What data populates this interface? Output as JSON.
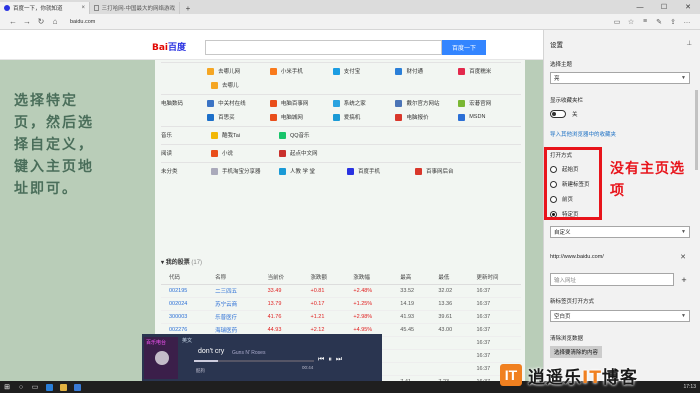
{
  "browser": {
    "tabs": [
      {
        "title": "百度一下，你就知道",
        "active": true
      },
      {
        "title": "三打哈网-中国最大的网络游戏",
        "active": false
      }
    ],
    "address": "baidu.com"
  },
  "baidu": {
    "logo_left": "Bai",
    "logo_right": "百度",
    "search_button": "百度一下"
  },
  "side_note": "选择特定页，然后选择自定义，键入主页地址即可。",
  "nav_rows": [
    {
      "category": "",
      "sites": [
        "去哪儿网",
        "小米手机",
        "支付宝",
        "财付通",
        "百度糯米"
      ]
    },
    {
      "category": "",
      "sites": [
        "去哪儿",
        "",
        "",
        "",
        ""
      ]
    },
    {
      "category": "电脑数码",
      "sites": [
        "中关村在线",
        "电脑百事网",
        "系统之家",
        "戴尔官方网站",
        "宏碁官网"
      ]
    },
    {
      "category": "",
      "sites": [
        "百思买",
        "电脑城网",
        "爱搞机",
        "电脑报价",
        "MSDN"
      ]
    },
    {
      "category": "音乐",
      "sites": [
        "酷我Tai",
        "QQ音乐",
        "",
        "",
        ""
      ]
    },
    {
      "category": "阅读",
      "sites": [
        "小说",
        "起点中文网",
        "",
        "",
        ""
      ]
    },
    {
      "category": "未分类",
      "sites": [
        "手机淘宝分享器",
        "人教 学 堂",
        "百度手机",
        "百事网后台",
        ""
      ]
    }
  ],
  "stocks": {
    "header": "我的股票",
    "count": "(17)",
    "columns": [
      "代码",
      "名称",
      "当前价",
      "涨跌额",
      "涨跌幅",
      "最高",
      "最低",
      "更新时间"
    ],
    "rows": [
      [
        "002195",
        "二三四五",
        "33.49",
        "+0.81",
        "+2.48%",
        "33.52",
        "32.02",
        "16:37"
      ],
      [
        "002024",
        "苏宁云商",
        "13.79",
        "+0.17",
        "+1.25%",
        "14.19",
        "13.36",
        "16:37"
      ],
      [
        "300003",
        "乐普医疗",
        "41.76",
        "+1.21",
        "+2.98%",
        "41.93",
        "39.61",
        "16:37"
      ],
      [
        "002276",
        "海瑞医药",
        "44.93",
        "+2.12",
        "+4.95%",
        "45.45",
        "43.00",
        "16:37"
      ],
      [
        "002310",
        "东方园林",
        "38.30",
        "0.00",
        "",
        "",
        "",
        "16:37"
      ],
      [
        "",
        "",
        "",
        "",
        "",
        "",
        "",
        "16:37"
      ],
      [
        "",
        "",
        "",
        "",
        "",
        "",
        "",
        "16:37"
      ],
      [
        "000789",
        "万年青",
        "7.36",
        "-0.01",
        "+0.79%",
        "7.41",
        "7.23",
        "16:37"
      ]
    ]
  },
  "music": {
    "cover_text": "百乐电台",
    "info": "英文",
    "song": "don't cry",
    "artist": "Guns N' Roses",
    "source": "酷狗",
    "time": "00:44",
    "progress": 0.2
  },
  "settings": {
    "title": "设置",
    "theme_label": "选择主题",
    "theme_value": "亮",
    "favbar_label": "显示收藏夹栏",
    "favbar_toggle": "关",
    "import_link": "导入其他浏览器中的收藏夹",
    "open_with_label": "打开方式",
    "open_options": [
      "起始页",
      "新建标签页",
      "前页",
      "特定页"
    ],
    "open_selected": 3,
    "custom_value": "自定义",
    "home_url": "http://www.baidu.com/",
    "url_placeholder": "输入网址",
    "newtab_label": "新标签页打开方式",
    "newtab_value": "空白页",
    "clear_label": "清除浏览数据",
    "clear_button": "选择要清除的内容"
  },
  "annotation": "没有主页选项",
  "watermark": {
    "logo": "IT",
    "text_a": "逍遥乐",
    "text_it": "IT",
    "text_b": "博客"
  },
  "taskbar": {
    "clock": "17:13"
  },
  "colors": {
    "accent": "#3385ff",
    "annotation": "#e8141b",
    "link": "#1a6fc4"
  }
}
